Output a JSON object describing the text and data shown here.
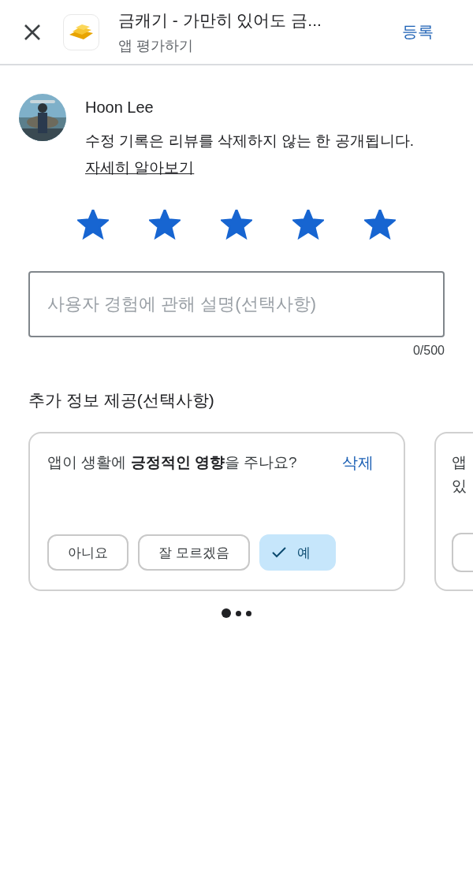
{
  "header": {
    "title": "금캐기 - 가만히 있어도 금...",
    "subtitle": "앱 평가하기",
    "action": "등록"
  },
  "review": {
    "user": "Hoon Lee",
    "notice": "수정 기록은 리뷰를 삭제하지 않는 한 공개됩니다.",
    "link": "자세히 알아보기",
    "stars": 5
  },
  "description": {
    "placeholder": "사용자 경험에 관해 설명(선택사항)",
    "counter": "0/500"
  },
  "extra": {
    "title": "추가 정보 제공(선택사항)",
    "cards": [
      {
        "question": "앱이 생활에 **긍정적인 영향**을 주나요?",
        "action": "삭제",
        "options": [
          {
            "label": "아니요",
            "selected": false
          },
          {
            "label": "잘 모르겠음",
            "selected": false
          },
          {
            "label": "예",
            "selected": true
          }
        ]
      },
      {
        "question_lines": [
          "앱",
          "있"
        ]
      }
    ],
    "dots": [
      {
        "selected": true
      },
      {
        "selected": false
      },
      {
        "selected": false
      }
    ]
  }
}
